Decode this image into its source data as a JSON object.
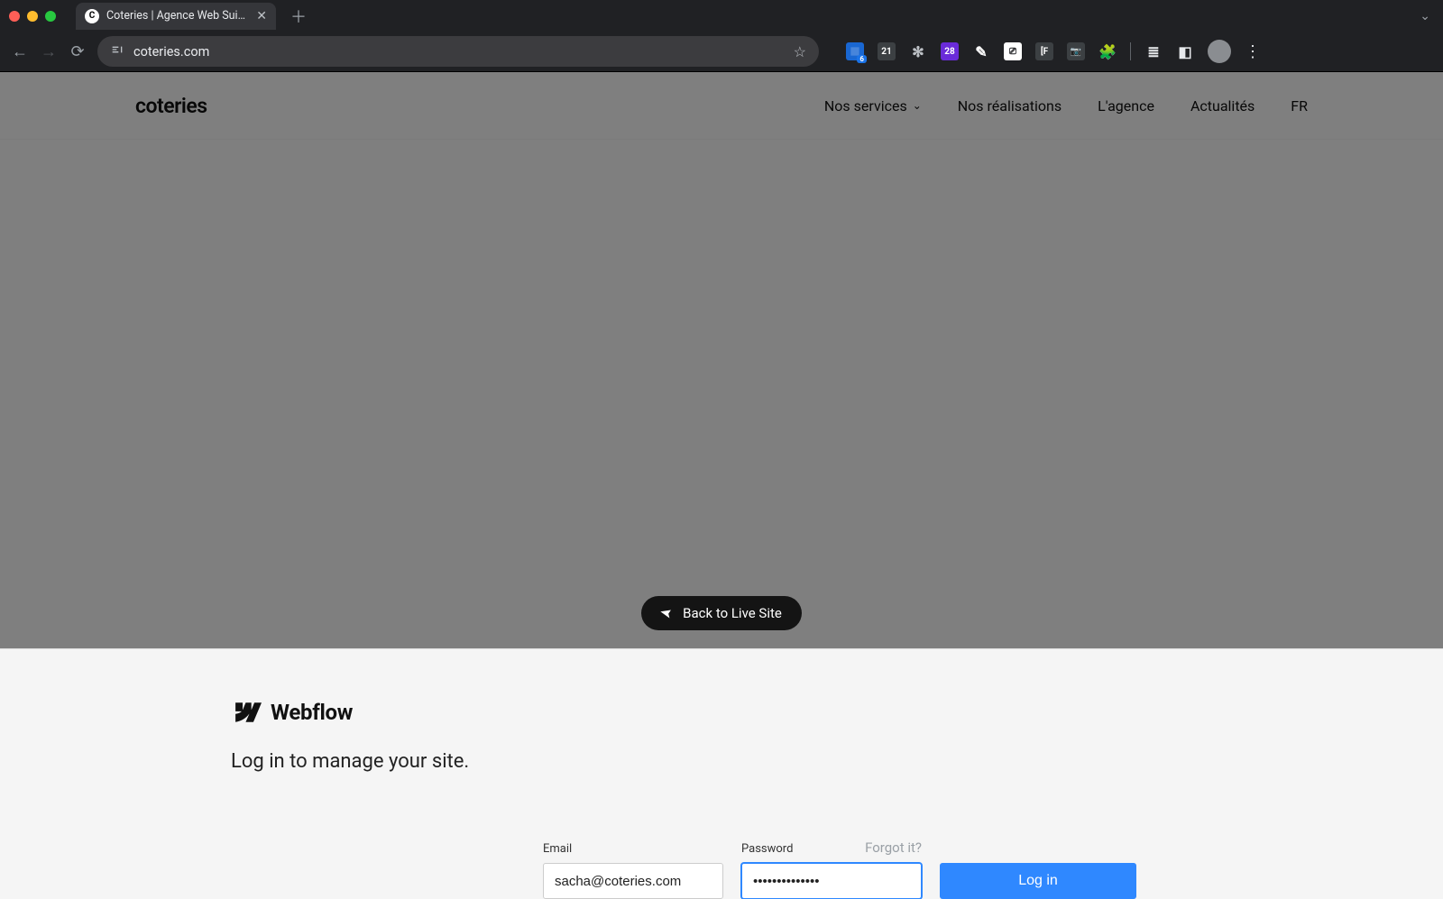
{
  "browser": {
    "tab": {
      "title": "Coteries | Agence Web Suisse"
    },
    "url": "coteries.com",
    "extensions": {
      "e1_badge": "6",
      "e2_text": "21",
      "e4_text": "28",
      "e7_text": "[F"
    }
  },
  "site": {
    "logo": "coteries",
    "links": {
      "services": "Nos services",
      "realisations": "Nos réalisations",
      "agence": "L'agence",
      "actualites": "Actualités",
      "lang": "FR"
    }
  },
  "overlay": {
    "back_button": "Back to Live Site"
  },
  "webflow": {
    "brand": "Webflow",
    "subtitle": "Log in to manage your site.",
    "email": {
      "label": "Email",
      "value": "sacha@coteries.com"
    },
    "password": {
      "label": "Password",
      "value": "••••••••••••••",
      "forgot": "Forgot it?"
    },
    "login_button": "Log in"
  }
}
